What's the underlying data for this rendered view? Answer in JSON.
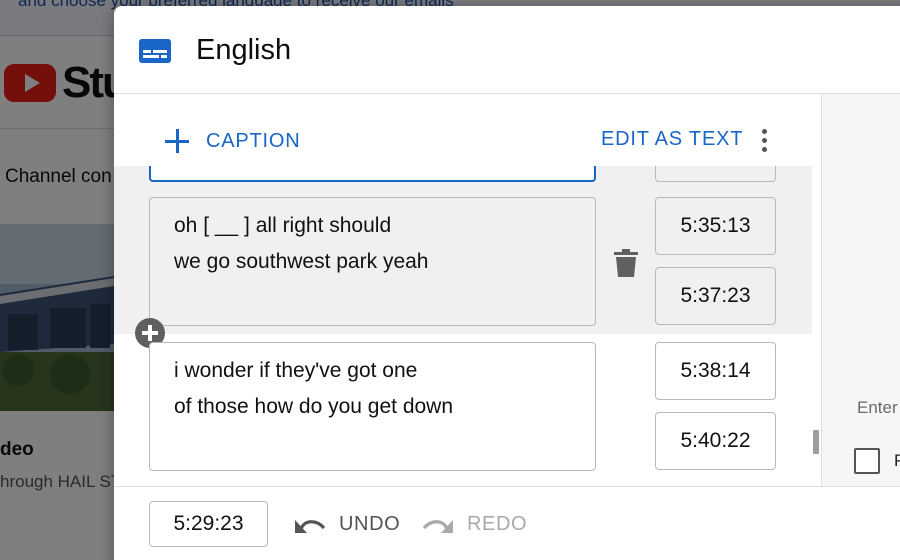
{
  "background": {
    "banner_text": "and choose your preferred language to receive our emails",
    "studio_label": "Stu",
    "channel_label": "Channel con",
    "video_title": "deo",
    "video_desc": "hrough HAIL ST"
  },
  "dialog": {
    "title": "English",
    "title_icon": "subtitles-icon"
  },
  "toolbar": {
    "add_caption_label": "CAPTION",
    "edit_as_text_label": "EDIT AS TEXT",
    "more_icon": "more-vert-icon"
  },
  "captions": [
    {
      "line1": "",
      "line2": "",
      "start": "",
      "end": ""
    },
    {
      "line1": "oh [ __ ] all right should",
      "line2": "we go southwest park yeah",
      "start": "5:35:13",
      "end": "5:37:23"
    },
    {
      "line1": "i wonder if they've got one",
      "line2": "of those how do you get down",
      "start": "5:38:14",
      "end": "5:40:22"
    }
  ],
  "side_panel": {
    "input_placeholder": "Enter",
    "checkbox_label": "P"
  },
  "footer": {
    "current_time": "5:29:23",
    "undo_label": "UNDO",
    "redo_label": "REDO"
  },
  "colors": {
    "accent": "#1a65c8",
    "youtube_red": "#e62117",
    "row_highlight": "#f0f0f0"
  }
}
